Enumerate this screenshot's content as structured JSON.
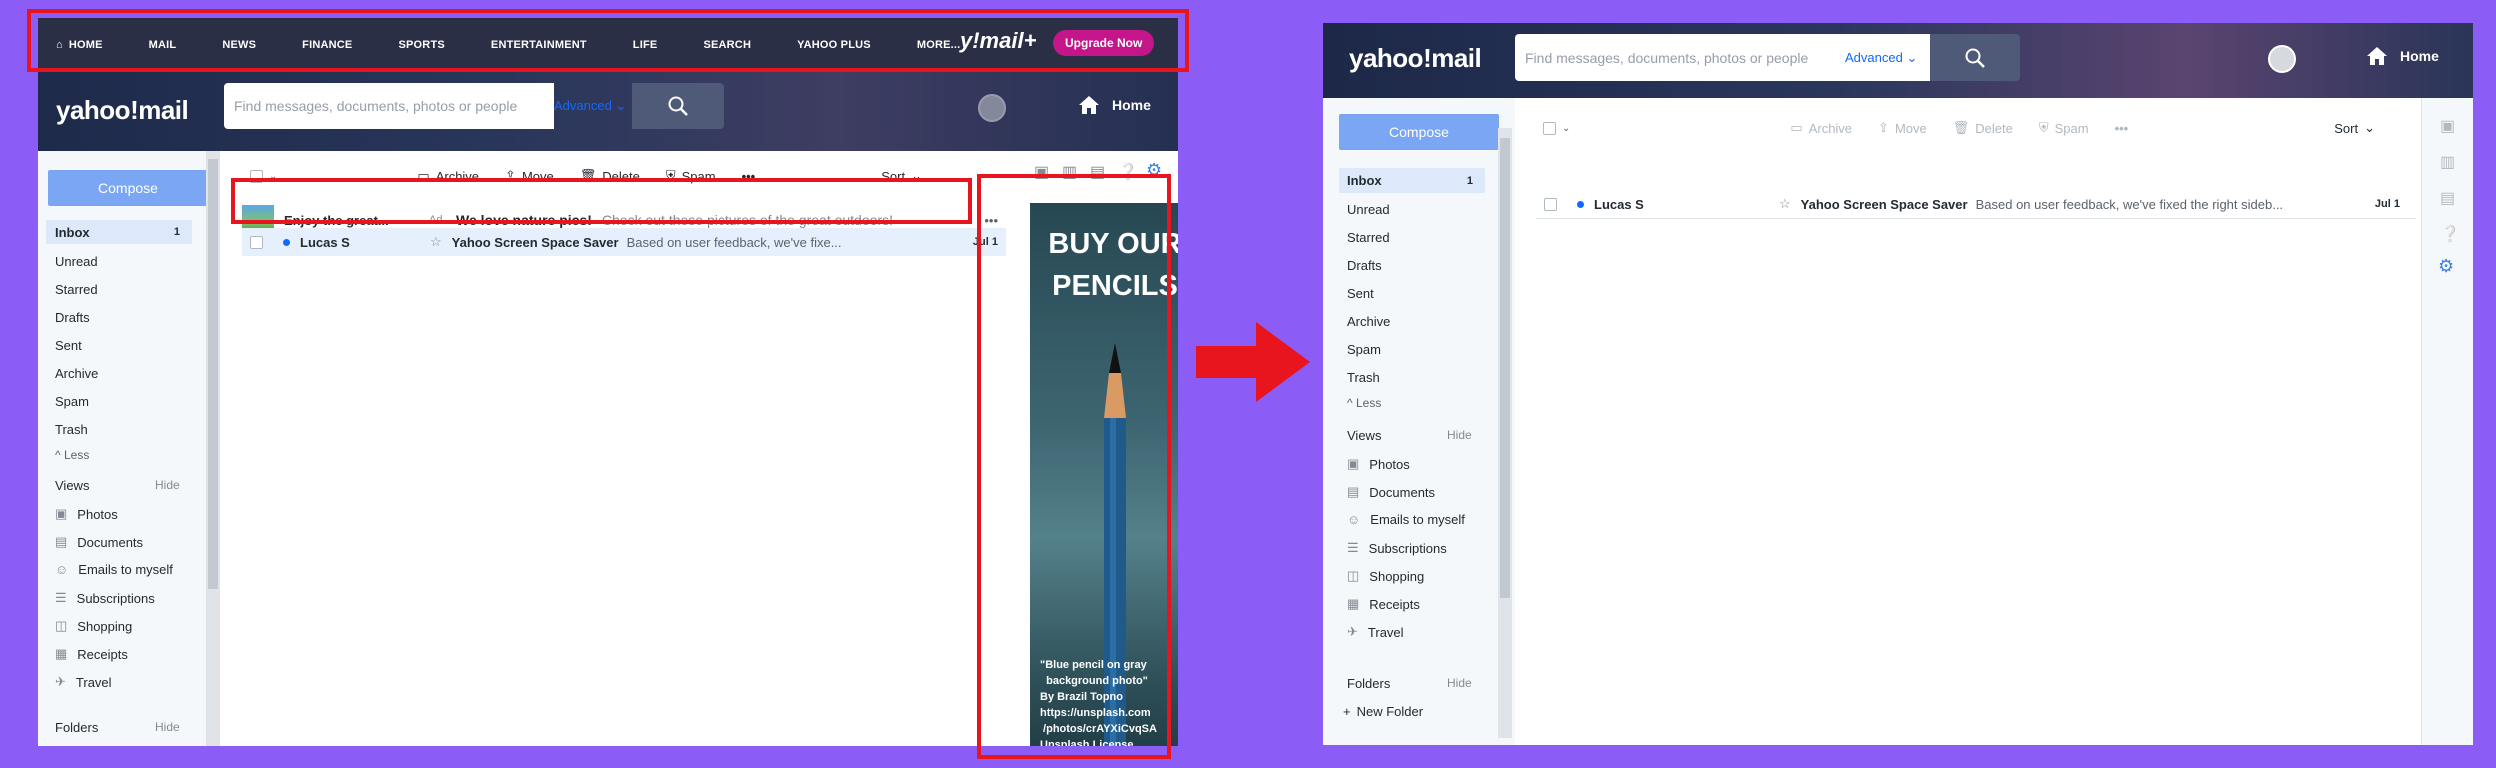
{
  "top_nav": {
    "items": [
      "HOME",
      "MAIL",
      "NEWS",
      "FINANCE",
      "SPORTS",
      "ENTERTAINMENT",
      "LIFE",
      "SEARCH",
      "YAHOO PLUS",
      "MORE..."
    ],
    "brand": "y!mail+",
    "upgrade_label": "Upgrade Now"
  },
  "brand": {
    "logo": "yahoo!mail"
  },
  "search": {
    "placeholder": "Find messages, documents, photos or people",
    "advanced_label": "Advanced"
  },
  "header": {
    "home_label": "Home"
  },
  "sidebar": {
    "compose_label": "Compose",
    "folders": [
      {
        "label": "Inbox",
        "count": "1"
      },
      {
        "label": "Unread"
      },
      {
        "label": "Starred"
      },
      {
        "label": "Drafts"
      },
      {
        "label": "Sent"
      },
      {
        "label": "Archive"
      },
      {
        "label": "Spam"
      },
      {
        "label": "Trash"
      }
    ],
    "less_label": "Less",
    "views_label": "Views",
    "hide_label": "Hide",
    "views": [
      "Photos",
      "Documents",
      "Emails to myself",
      "Subscriptions",
      "Shopping",
      "Receipts",
      "Travel"
    ],
    "folders_label": "Folders",
    "new_folder_label": "New Folder"
  },
  "toolbar": {
    "archive": "Archive",
    "move": "Move",
    "delete": "Delete",
    "spam": "Spam",
    "sort": "Sort"
  },
  "ad_row": {
    "sender": "Enjoy the great...",
    "badge": "Ad",
    "subject": "We love nature pics!",
    "snippet": "Check out these pictures of the great outdoors!"
  },
  "messages": [
    {
      "sender": "Lucas S",
      "subject": "Yahoo Screen Space Saver",
      "snippet_left": "Based on user feedback, we've fixe...",
      "snippet_right": "Based on user feedback, we've fixed the right sideb...",
      "date": "Jul 1"
    }
  ],
  "ad_banner": {
    "title_line1": "BUY OUR",
    "title_line2": "PENCILS",
    "caption": "\"Blue pencil on gray\n  background photo\"\nBy Brazil Topno\nhttps://unsplash.com\n /photos/crAYXiCvqSA\nUnsplash License"
  },
  "colors": {
    "background": "#8c5cf6",
    "highlight": "#e8141e",
    "accent": "#0f69ff",
    "upgrade": "#c4158a"
  }
}
